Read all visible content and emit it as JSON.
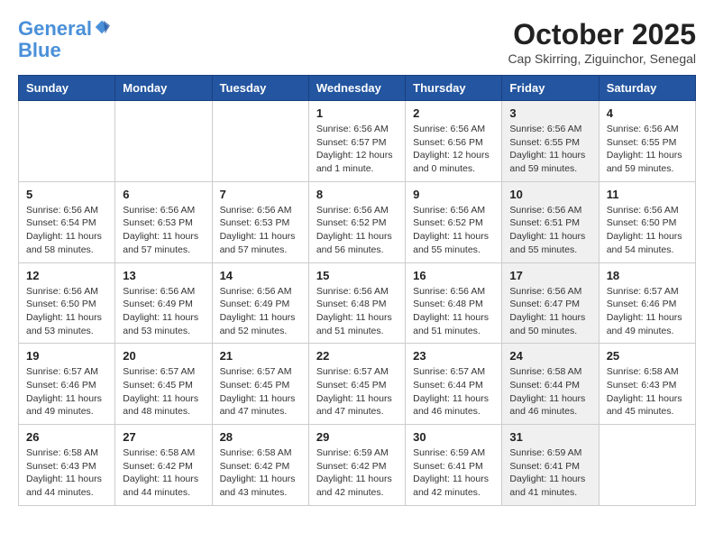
{
  "header": {
    "logo_line1": "General",
    "logo_line2": "Blue",
    "month": "October 2025",
    "location": "Cap Skirring, Ziguinchor, Senegal"
  },
  "weekdays": [
    "Sunday",
    "Monday",
    "Tuesday",
    "Wednesday",
    "Thursday",
    "Friday",
    "Saturday"
  ],
  "weeks": [
    [
      {
        "day": null,
        "sunrise": null,
        "sunset": null,
        "daylight": null,
        "shaded": false
      },
      {
        "day": null,
        "sunrise": null,
        "sunset": null,
        "daylight": null,
        "shaded": false
      },
      {
        "day": null,
        "sunrise": null,
        "sunset": null,
        "daylight": null,
        "shaded": false
      },
      {
        "day": "1",
        "sunrise": "6:56 AM",
        "sunset": "6:57 PM",
        "daylight": "12 hours and 1 minute.",
        "shaded": false
      },
      {
        "day": "2",
        "sunrise": "6:56 AM",
        "sunset": "6:56 PM",
        "daylight": "12 hours and 0 minutes.",
        "shaded": false
      },
      {
        "day": "3",
        "sunrise": "6:56 AM",
        "sunset": "6:55 PM",
        "daylight": "11 hours and 59 minutes.",
        "shaded": true
      },
      {
        "day": "4",
        "sunrise": "6:56 AM",
        "sunset": "6:55 PM",
        "daylight": "11 hours and 59 minutes.",
        "shaded": false
      }
    ],
    [
      {
        "day": "5",
        "sunrise": "6:56 AM",
        "sunset": "6:54 PM",
        "daylight": "11 hours and 58 minutes.",
        "shaded": false
      },
      {
        "day": "6",
        "sunrise": "6:56 AM",
        "sunset": "6:53 PM",
        "daylight": "11 hours and 57 minutes.",
        "shaded": false
      },
      {
        "day": "7",
        "sunrise": "6:56 AM",
        "sunset": "6:53 PM",
        "daylight": "11 hours and 57 minutes.",
        "shaded": false
      },
      {
        "day": "8",
        "sunrise": "6:56 AM",
        "sunset": "6:52 PM",
        "daylight": "11 hours and 56 minutes.",
        "shaded": false
      },
      {
        "day": "9",
        "sunrise": "6:56 AM",
        "sunset": "6:52 PM",
        "daylight": "11 hours and 55 minutes.",
        "shaded": false
      },
      {
        "day": "10",
        "sunrise": "6:56 AM",
        "sunset": "6:51 PM",
        "daylight": "11 hours and 55 minutes.",
        "shaded": true
      },
      {
        "day": "11",
        "sunrise": "6:56 AM",
        "sunset": "6:50 PM",
        "daylight": "11 hours and 54 minutes.",
        "shaded": false
      }
    ],
    [
      {
        "day": "12",
        "sunrise": "6:56 AM",
        "sunset": "6:50 PM",
        "daylight": "11 hours and 53 minutes.",
        "shaded": false
      },
      {
        "day": "13",
        "sunrise": "6:56 AM",
        "sunset": "6:49 PM",
        "daylight": "11 hours and 53 minutes.",
        "shaded": false
      },
      {
        "day": "14",
        "sunrise": "6:56 AM",
        "sunset": "6:49 PM",
        "daylight": "11 hours and 52 minutes.",
        "shaded": false
      },
      {
        "day": "15",
        "sunrise": "6:56 AM",
        "sunset": "6:48 PM",
        "daylight": "11 hours and 51 minutes.",
        "shaded": false
      },
      {
        "day": "16",
        "sunrise": "6:56 AM",
        "sunset": "6:48 PM",
        "daylight": "11 hours and 51 minutes.",
        "shaded": false
      },
      {
        "day": "17",
        "sunrise": "6:56 AM",
        "sunset": "6:47 PM",
        "daylight": "11 hours and 50 minutes.",
        "shaded": true
      },
      {
        "day": "18",
        "sunrise": "6:57 AM",
        "sunset": "6:46 PM",
        "daylight": "11 hours and 49 minutes.",
        "shaded": false
      }
    ],
    [
      {
        "day": "19",
        "sunrise": "6:57 AM",
        "sunset": "6:46 PM",
        "daylight": "11 hours and 49 minutes.",
        "shaded": false
      },
      {
        "day": "20",
        "sunrise": "6:57 AM",
        "sunset": "6:45 PM",
        "daylight": "11 hours and 48 minutes.",
        "shaded": false
      },
      {
        "day": "21",
        "sunrise": "6:57 AM",
        "sunset": "6:45 PM",
        "daylight": "11 hours and 47 minutes.",
        "shaded": false
      },
      {
        "day": "22",
        "sunrise": "6:57 AM",
        "sunset": "6:45 PM",
        "daylight": "11 hours and 47 minutes.",
        "shaded": false
      },
      {
        "day": "23",
        "sunrise": "6:57 AM",
        "sunset": "6:44 PM",
        "daylight": "11 hours and 46 minutes.",
        "shaded": false
      },
      {
        "day": "24",
        "sunrise": "6:58 AM",
        "sunset": "6:44 PM",
        "daylight": "11 hours and 46 minutes.",
        "shaded": true
      },
      {
        "day": "25",
        "sunrise": "6:58 AM",
        "sunset": "6:43 PM",
        "daylight": "11 hours and 45 minutes.",
        "shaded": false
      }
    ],
    [
      {
        "day": "26",
        "sunrise": "6:58 AM",
        "sunset": "6:43 PM",
        "daylight": "11 hours and 44 minutes.",
        "shaded": false
      },
      {
        "day": "27",
        "sunrise": "6:58 AM",
        "sunset": "6:42 PM",
        "daylight": "11 hours and 44 minutes.",
        "shaded": false
      },
      {
        "day": "28",
        "sunrise": "6:58 AM",
        "sunset": "6:42 PM",
        "daylight": "11 hours and 43 minutes.",
        "shaded": false
      },
      {
        "day": "29",
        "sunrise": "6:59 AM",
        "sunset": "6:42 PM",
        "daylight": "11 hours and 42 minutes.",
        "shaded": false
      },
      {
        "day": "30",
        "sunrise": "6:59 AM",
        "sunset": "6:41 PM",
        "daylight": "11 hours and 42 minutes.",
        "shaded": false
      },
      {
        "day": "31",
        "sunrise": "6:59 AM",
        "sunset": "6:41 PM",
        "daylight": "11 hours and 41 minutes.",
        "shaded": true
      },
      {
        "day": null,
        "sunrise": null,
        "sunset": null,
        "daylight": null,
        "shaded": false
      }
    ]
  ]
}
